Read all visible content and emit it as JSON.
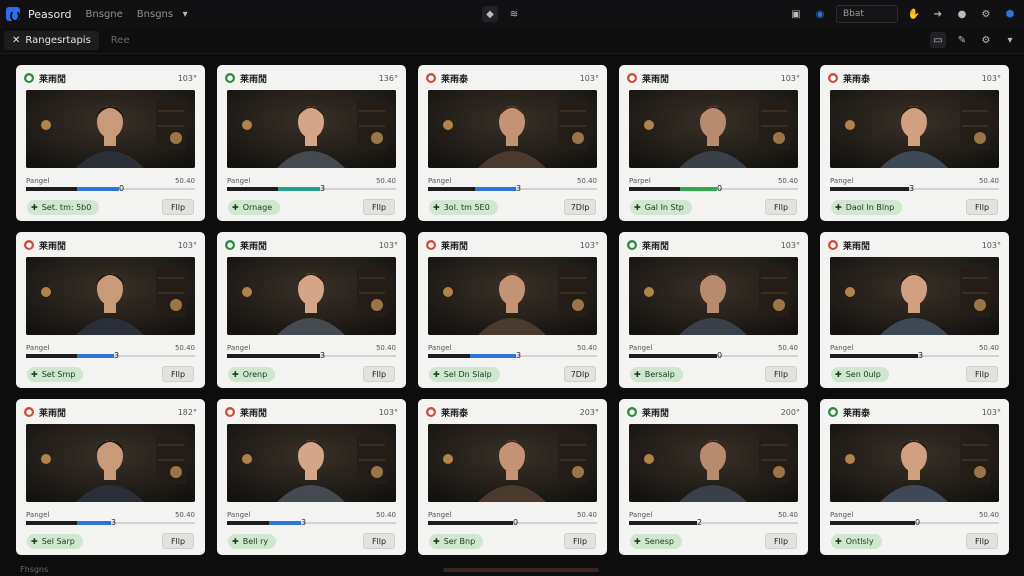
{
  "app": {
    "title": "Peasord",
    "menu": [
      "Bnsgne",
      "Bnsgns"
    ]
  },
  "topbar": {
    "search_placeholder": "Bbat"
  },
  "subbar": {
    "tabs": [
      {
        "label": "Rangesrtapis",
        "active": true
      },
      {
        "label": "Ree",
        "active": false
      }
    ]
  },
  "colors": {
    "red": "#d14b36",
    "green": "#2e8b3b",
    "blue": "#2d74d8",
    "teal": "#23a28a",
    "bright_green": "#2fa84f"
  },
  "cards": [
    {
      "title": "莱雨閒",
      "meta": "103°",
      "status": "green",
      "left": "Pangel",
      "right": "50.40",
      "progress": 0.55,
      "accent": "blue",
      "accent_from": 0.3,
      "mark": "0",
      "pill": "Set. tm: 5b0",
      "button": "Fllp"
    },
    {
      "title": "莱雨閒",
      "meta": "136°",
      "status": "green",
      "left": "Pangel",
      "right": "50.40",
      "progress": 0.55,
      "accent": "teal",
      "accent_from": 0.3,
      "mark": "3",
      "pill": "Ornage",
      "button": "Fllp"
    },
    {
      "title": "莱雨泰",
      "meta": "103°",
      "status": "red",
      "left": "Pangel",
      "right": "50.40",
      "progress": 0.52,
      "accent": "blue",
      "accent_from": 0.28,
      "mark": "3",
      "pill": "3ol. tm 5E0",
      "button": "7Dlp"
    },
    {
      "title": "莱雨閒",
      "meta": "103°",
      "status": "red",
      "left": "Parpel",
      "right": "50.40",
      "progress": 0.52,
      "accent": "bright_green",
      "accent_from": 0.3,
      "mark": "0",
      "pill": "Gal In Stp",
      "button": "Fllp"
    },
    {
      "title": "莱雨泰",
      "meta": "103°",
      "status": "red",
      "left": "Pangel",
      "right": "50.40",
      "progress": 0.47,
      "accent": "blue",
      "accent_from": 0.47,
      "mark": "3",
      "pill": "Daol In Blnp",
      "button": "Fllp"
    },
    {
      "title": "莱雨閒",
      "meta": "103°",
      "status": "red",
      "left": "Pangel",
      "right": "50.40",
      "progress": 0.52,
      "accent": "blue",
      "accent_from": 0.3,
      "mark": "3",
      "pill": "Set Smp",
      "button": "Fllp"
    },
    {
      "title": "莱雨閒",
      "meta": "103°",
      "status": "green",
      "left": "Pangel",
      "right": "50.40",
      "progress": 0.55,
      "accent": "blue",
      "accent_from": 0.55,
      "mark": "3",
      "pill": "Orenp",
      "button": "Fllp"
    },
    {
      "title": "莱雨閒",
      "meta": "103°",
      "status": "red",
      "left": "Pangel",
      "right": "50.40",
      "progress": 0.52,
      "accent": "blue",
      "accent_from": 0.25,
      "mark": "3",
      "pill": "Sel Dn Slalp",
      "button": "7Dlp"
    },
    {
      "title": "莱雨閒",
      "meta": "103°",
      "status": "green",
      "left": "Pangel",
      "right": "50.40",
      "progress": 0.52,
      "accent": "blue",
      "accent_from": 0.52,
      "mark": "0",
      "pill": "Bersalp",
      "button": "Fllp"
    },
    {
      "title": "莱雨閒",
      "meta": "103°",
      "status": "red",
      "left": "Pangel",
      "right": "50.40",
      "progress": 0.52,
      "accent": "blue",
      "accent_from": 0.52,
      "mark": "3",
      "pill": "Sen 0ulp",
      "button": "Fllp"
    },
    {
      "title": "莱雨閒",
      "meta": "182°",
      "status": "red",
      "left": "Pangel",
      "right": "50.40",
      "progress": 0.5,
      "accent": "blue",
      "accent_from": 0.3,
      "mark": "3",
      "pill": "Sel Sarp",
      "button": "Fllp"
    },
    {
      "title": "莱雨閒",
      "meta": "103°",
      "status": "red",
      "left": "Pangel",
      "right": "50.40",
      "progress": 0.44,
      "accent": "blue",
      "accent_from": 0.25,
      "mark": "3",
      "pill": "Bell ry",
      "button": "Fllp"
    },
    {
      "title": "莱雨泰",
      "meta": "203°",
      "status": "red",
      "left": "Pangel",
      "right": "50.40",
      "progress": 0.5,
      "accent": "blue",
      "accent_from": 0.5,
      "mark": "0",
      "pill": "Ser Bnp",
      "button": "Fllp"
    },
    {
      "title": "莱雨閒",
      "meta": "200°",
      "status": "green",
      "left": "Pangel",
      "right": "50.40",
      "progress": 0.4,
      "accent": "blue",
      "accent_from": 0.4,
      "mark": "2",
      "pill": "Senesp",
      "button": "Fllp"
    },
    {
      "title": "莱雨泰",
      "meta": "103°",
      "status": "green",
      "left": "Pangel",
      "right": "50.40",
      "progress": 0.5,
      "accent": "blue",
      "accent_from": 0.5,
      "mark": "0",
      "pill": "Ontlsly",
      "button": "Fllp"
    }
  ],
  "bottombar": {
    "label": "Fhsgns"
  }
}
